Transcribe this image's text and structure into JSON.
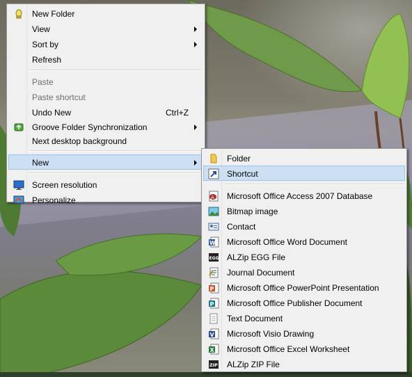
{
  "context_menu": {
    "items": [
      {
        "label": "New Folder",
        "icon": "new-folder-icon"
      },
      {
        "label": "View"
      },
      {
        "label": "Sort by"
      },
      {
        "label": "Refresh"
      },
      {
        "label": "Paste"
      },
      {
        "label": "Paste shortcut"
      },
      {
        "label": "Undo New",
        "shortcut": "Ctrl+Z"
      },
      {
        "label": "Groove Folder Synchronization",
        "icon": "groove-sync-icon"
      },
      {
        "label": "Next desktop background"
      },
      {
        "label": "New"
      },
      {
        "label": "Screen resolution",
        "icon": "screen-resolution-icon"
      },
      {
        "label": "Personalize",
        "icon": "personalize-icon"
      }
    ]
  },
  "new_submenu": {
    "items": [
      {
        "label": "Folder",
        "icon": "folder-icon"
      },
      {
        "label": "Shortcut",
        "icon": "shortcut-icon"
      },
      {
        "label": "Microsoft Office Access 2007 Database",
        "icon": "access-db-icon"
      },
      {
        "label": "Bitmap image",
        "icon": "bitmap-icon"
      },
      {
        "label": "Contact",
        "icon": "contact-icon"
      },
      {
        "label": "Microsoft Office Word Document",
        "icon": "word-doc-icon"
      },
      {
        "label": "ALZip EGG File",
        "icon": "alzip-egg-icon"
      },
      {
        "label": "Journal Document",
        "icon": "journal-doc-icon"
      },
      {
        "label": "Microsoft Office PowerPoint Presentation",
        "icon": "powerpoint-icon"
      },
      {
        "label": "Microsoft Office Publisher Document",
        "icon": "publisher-icon"
      },
      {
        "label": "Text Document",
        "icon": "text-doc-icon"
      },
      {
        "label": "Microsoft Visio Drawing",
        "icon": "visio-icon"
      },
      {
        "label": "Microsoft Office Excel Worksheet",
        "icon": "excel-icon"
      },
      {
        "label": "ALZip ZIP File",
        "icon": "alzip-zip-icon"
      }
    ]
  },
  "colors": {
    "menu_bg": "#f0f0f0",
    "highlight": "#cde0f3",
    "highlight_border": "#9fc2e7",
    "disabled_text": "#6d6d6d"
  }
}
